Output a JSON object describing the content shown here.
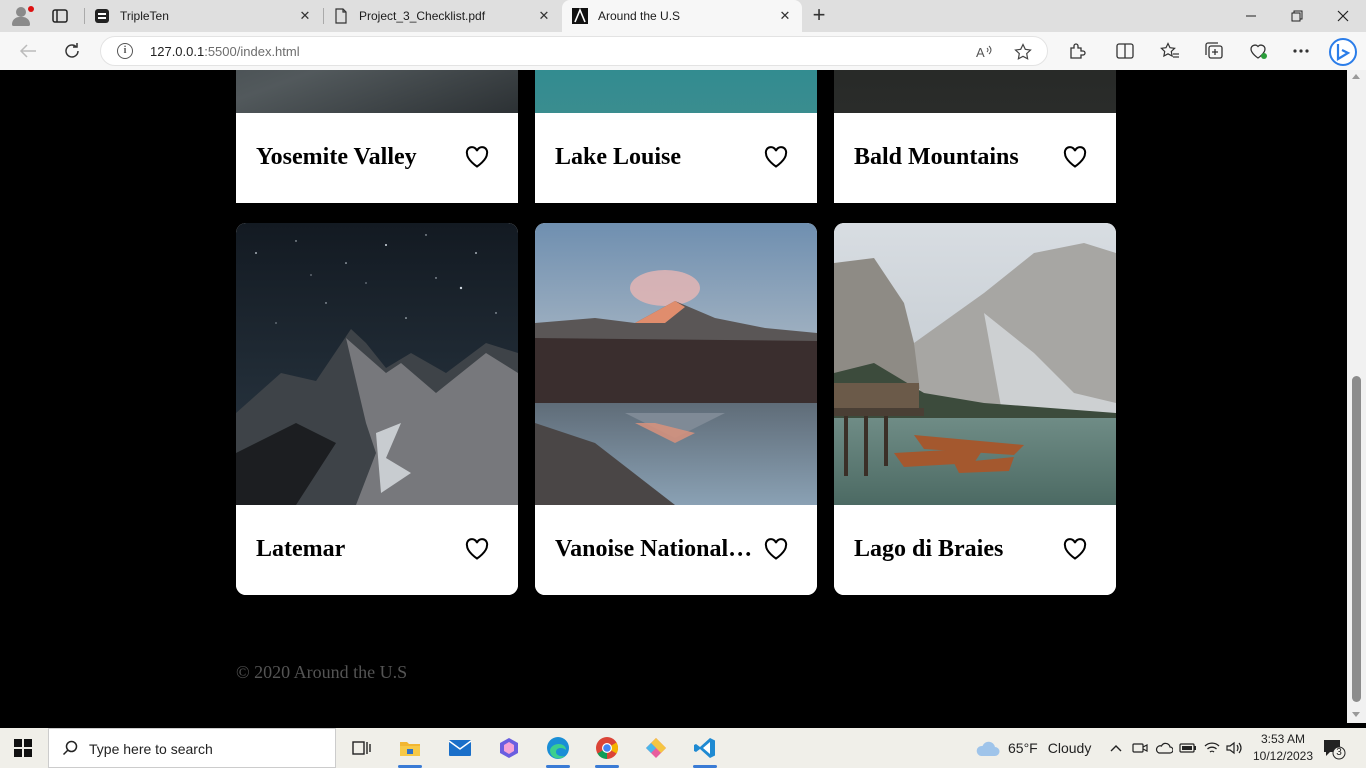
{
  "browser": {
    "tabs": [
      {
        "label": "TripleTen",
        "active": false
      },
      {
        "label": "Project_3_Checklist.pdf",
        "active": false
      },
      {
        "label": "Around the U.S",
        "active": true
      }
    ],
    "url_host": "127.0.0.1",
    "url_rest": ":5500/index.html"
  },
  "page": {
    "top_cards": [
      {
        "title": "Yosemite Valley"
      },
      {
        "title": "Lake Louise"
      },
      {
        "title": "Bald Mountains"
      }
    ],
    "cards": [
      {
        "title": "Latemar"
      },
      {
        "title": "Vanoise National Park"
      },
      {
        "title": "Lago di Braies"
      }
    ],
    "footer": "© 2020 Around the U.S"
  },
  "taskbar": {
    "search_placeholder": "Type here to search",
    "weather_temp": "65°F",
    "weather_text": "Cloudy",
    "time": "3:53 AM",
    "date": "10/12/2023",
    "notification_count": "3"
  },
  "colors": {
    "page_bg": "#000000",
    "card_bg": "#ffffff",
    "footer_text": "#545454"
  }
}
